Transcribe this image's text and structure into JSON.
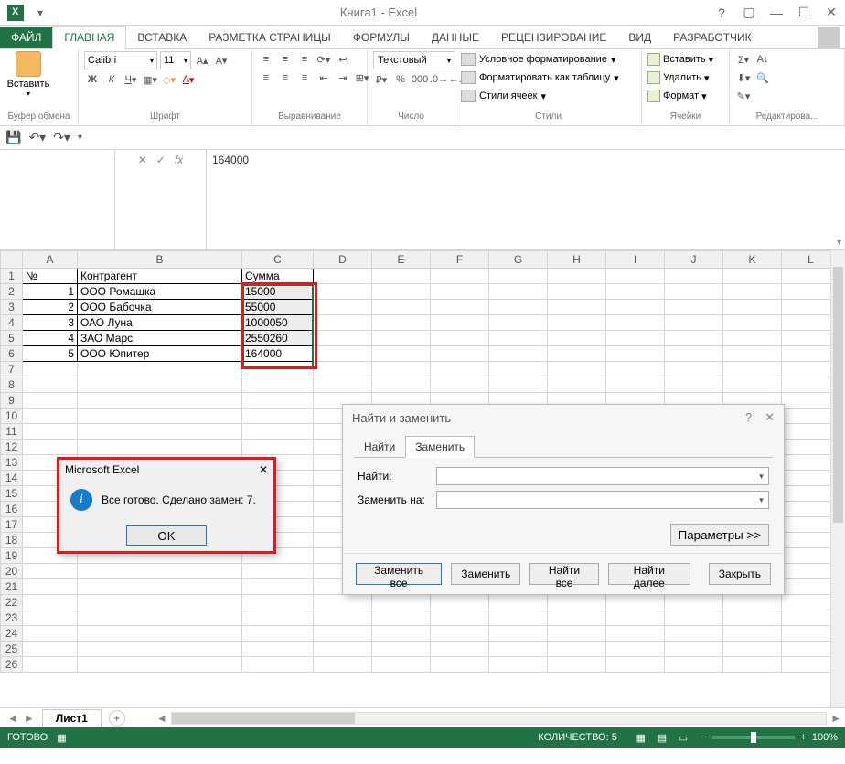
{
  "title": "Книга1 - Excel",
  "tabs": {
    "file": "ФАЙЛ",
    "home": "ГЛАВНАЯ",
    "insert": "ВСТАВКА",
    "layout": "РАЗМЕТКА СТРАНИЦЫ",
    "formulas": "ФОРМУЛЫ",
    "data": "ДАННЫЕ",
    "review": "РЕЦЕНЗИРОВАНИЕ",
    "view": "ВИД",
    "developer": "РАЗРАБОТЧИК"
  },
  "ribbon": {
    "clipboard": {
      "paste": "Вставить",
      "label": "Буфер обмена"
    },
    "font": {
      "name": "Calibri",
      "size": "11",
      "label": "Шрифт"
    },
    "align": {
      "label": "Выравнивание"
    },
    "number": {
      "format": "Текстовый",
      "label": "Число"
    },
    "styles": {
      "cond": "Условное форматирование",
      "table": "Форматировать как таблицу",
      "cell": "Стили ячеек",
      "label": "Стили"
    },
    "cells": {
      "insert": "Вставить",
      "delete": "Удалить",
      "format": "Формат",
      "label": "Ячейки"
    },
    "editing": {
      "label": "Редактирова..."
    }
  },
  "formula_bar": {
    "value": "164000",
    "fx": "fx"
  },
  "columns": [
    "A",
    "B",
    "C",
    "D",
    "E",
    "F",
    "G",
    "H",
    "I",
    "J",
    "K",
    "L"
  ],
  "headers": {
    "num": "№",
    "agent": "Контрагент",
    "sum": "Сумма"
  },
  "rows": [
    {
      "n": "1",
      "agent": "ООО Ромашка",
      "sum": "15000"
    },
    {
      "n": "2",
      "agent": "ООО Бабочка",
      "sum": "55000"
    },
    {
      "n": "3",
      "agent": "ОАО Луна",
      "sum": "1000050"
    },
    {
      "n": "4",
      "agent": "ЗАО Марс",
      "sum": "2550260"
    },
    {
      "n": "5",
      "agent": "ООО Юпитер",
      "sum": "164000"
    }
  ],
  "msg": {
    "title": "Microsoft Excel",
    "text": "Все готово. Сделано замен: 7.",
    "ok": "OK"
  },
  "fr": {
    "title": "Найти и заменить",
    "tab_find": "Найти",
    "tab_replace": "Заменить",
    "find_label": "Найти:",
    "replace_label": "Заменить на:",
    "params": "Параметры >>",
    "replace_all": "Заменить все",
    "replace": "Заменить",
    "find_all": "Найти все",
    "find_next": "Найти далее",
    "close": "Закрыть"
  },
  "sheet": {
    "name": "Лист1"
  },
  "status": {
    "ready": "ГОТОВО",
    "count": "КОЛИЧЕСТВО: 5",
    "zoom": "100%"
  }
}
